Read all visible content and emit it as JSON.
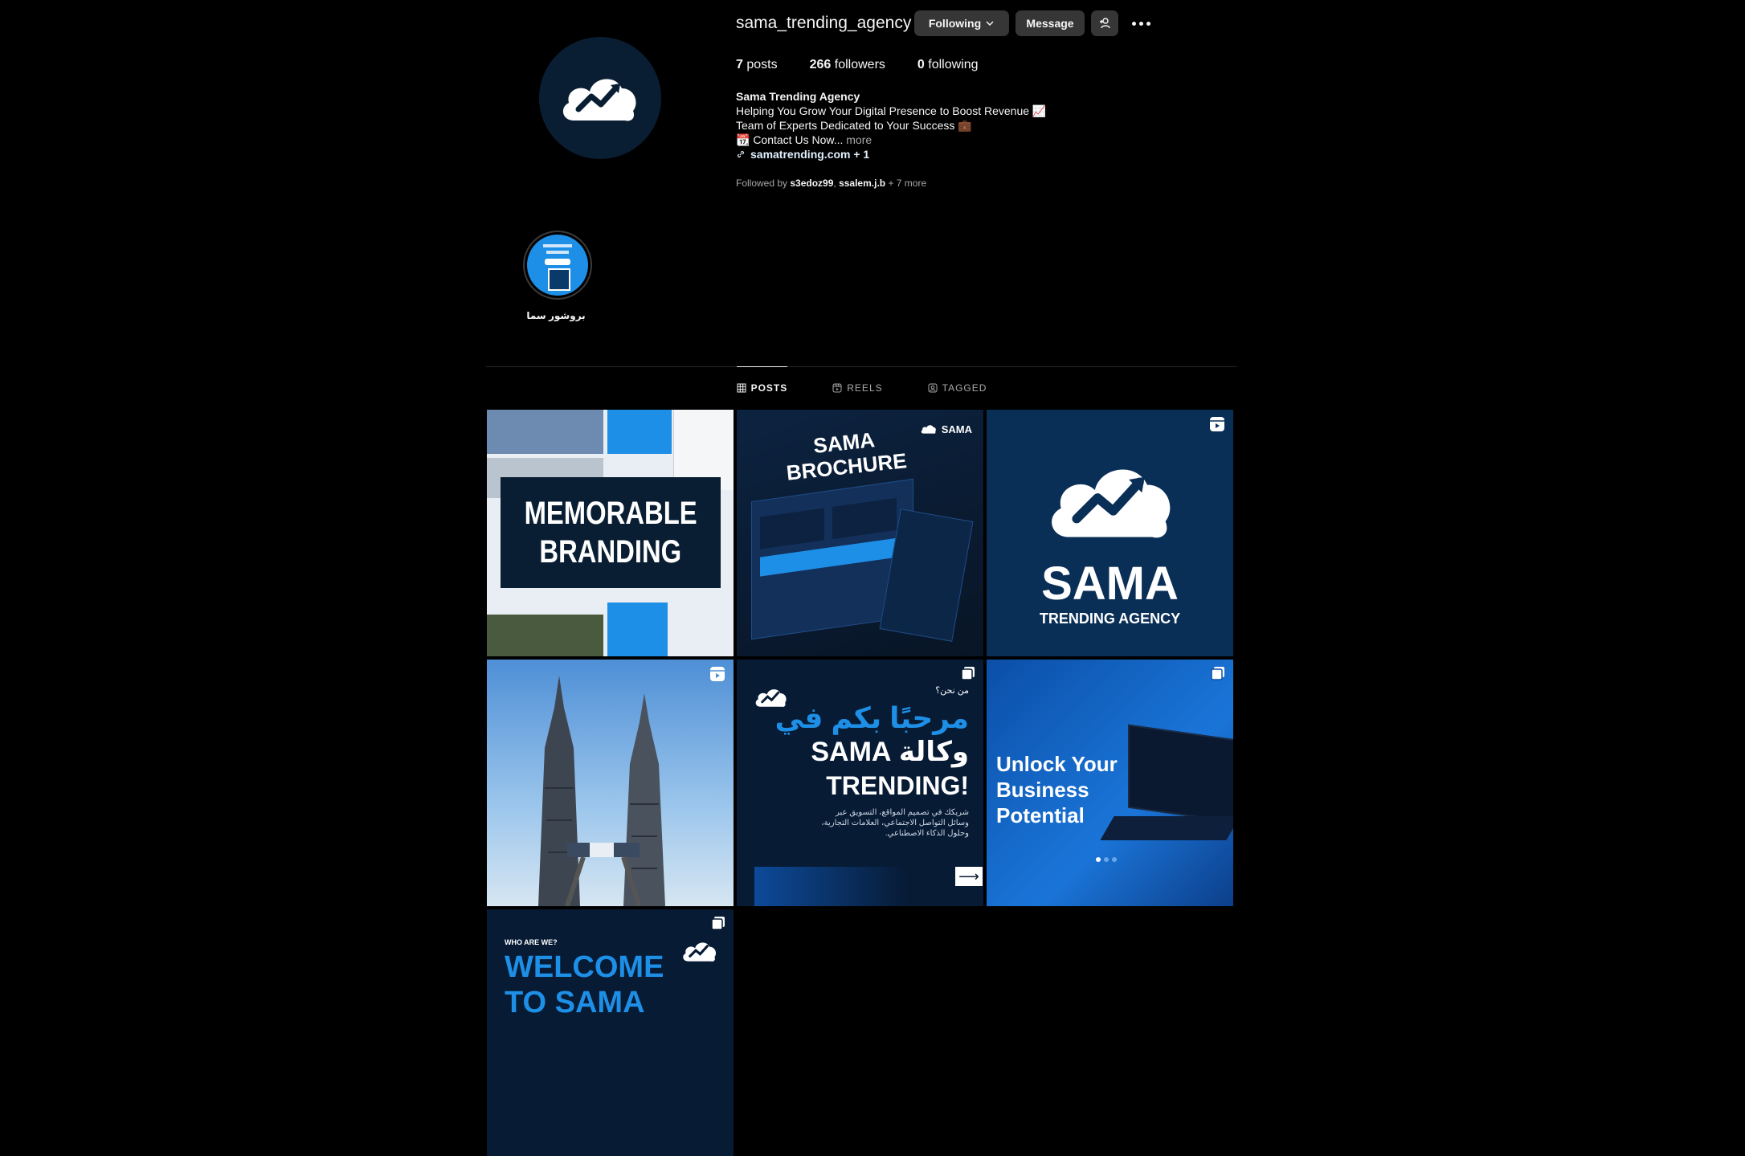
{
  "profile": {
    "username": "sama_trending_agency",
    "following_button": "Following",
    "message_button": "Message",
    "stats": {
      "posts_count": "7",
      "posts_label": "posts",
      "followers_count": "266",
      "followers_label": "followers",
      "following_count": "0",
      "following_label": "following"
    },
    "bio": {
      "name": "Sama Trending Agency",
      "line1": "Helping You Grow Your Digital Presence to Boost Revenue 📈",
      "line2": "Team of Experts Dedicated to Your Success 💼",
      "line3": "📆 Contact Us Now...",
      "more": "more",
      "link": "samatrending.com + 1"
    },
    "followed_by": {
      "prefix": "Followed by",
      "user1": "s3edoz99",
      "user2": "ssalem.j.b",
      "suffix": "+ 7 more"
    }
  },
  "highlight": {
    "label": "بروشور سما"
  },
  "tabs": [
    {
      "label": "POSTS",
      "active": true
    },
    {
      "label": "REELS",
      "active": false
    },
    {
      "label": "TAGGED",
      "active": false
    }
  ],
  "posts": {
    "p1": {
      "line1": "MEMORABLE",
      "line2": "BRANDING"
    },
    "p2": {
      "line1": "SAMA",
      "line2": "BROCHURE",
      "logo": "SAMA"
    },
    "p3": {
      "title": "SAMA",
      "subtitle": "TRENDING AGENCY"
    },
    "p5": {
      "question": "من نحن؟",
      "line1": "مرحبًا بكم في",
      "line2": "وكالة SAMA",
      "line3": "TRENDING!",
      "body": "شريكك في تصميم المواقع، التسويق عبر وسائل التواصل الاجتماعي، العلامات التجارية، وحلول الذكاء الاصطناعي."
    },
    "p6": {
      "line1": "Unlock Your",
      "line2": "Business",
      "line3": "Potential"
    },
    "p7": {
      "kicker": "WHO ARE WE?",
      "line1": "WELCOME",
      "line2": "TO SAMA"
    }
  },
  "icons": {
    "chevron": "chevron-down-icon",
    "add_user": "add-user-icon",
    "more": "more-options-icon",
    "link": "link-icon",
    "reel": "reel-icon",
    "carousel": "carousel-icon"
  },
  "colors": {
    "background": "#000000",
    "button": "#363636",
    "brand_blue": "#1e8fe6",
    "brand_navy": "#0a1e33"
  }
}
